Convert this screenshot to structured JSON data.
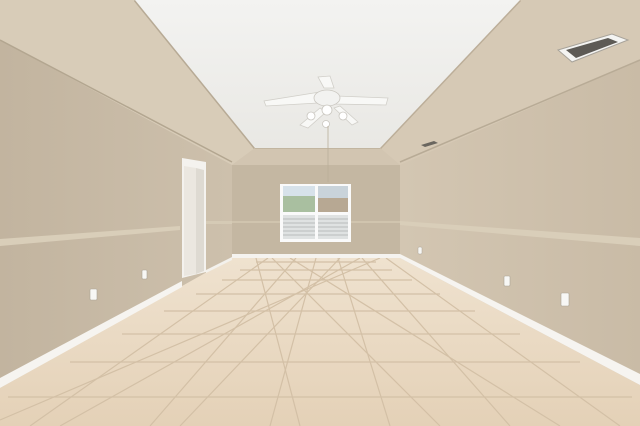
{
  "photo": {
    "scene": "empty-room-interior",
    "colors": {
      "wall_left": "#c9bca8",
      "wall_right": "#cdbfab",
      "wall_back": "#c4b7a2",
      "tray_ceiling": "#f1f1ef",
      "tray_border": "#dcd0bd",
      "tray_shadow": "#b9ac97",
      "chair_rail": "#d9ceb9",
      "baseboard": "#f5f3ef",
      "floor": "#ead9c2",
      "floor_grout": "#d2bfa6",
      "window_glass": "#cfd8de",
      "window_frame": "#fafafa",
      "door": "#f4f2ee",
      "fan": "#f7f7f5"
    }
  }
}
